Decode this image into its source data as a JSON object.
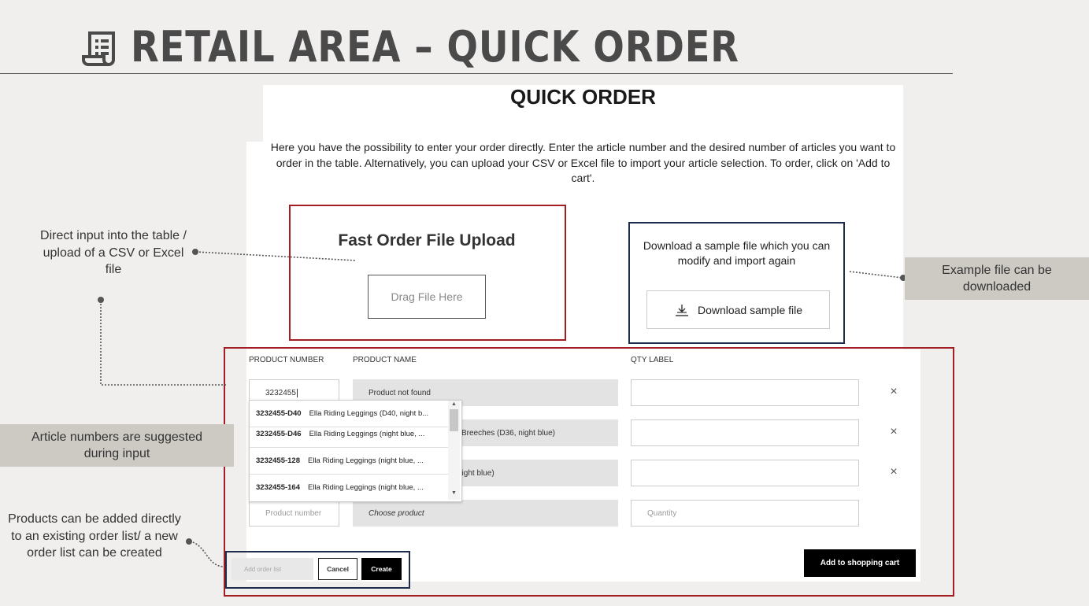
{
  "header": {
    "title": "RETAIL AREA – QUICK ORDER",
    "icon": "document-list-icon"
  },
  "quick_order": {
    "heading": "QUICK ORDER",
    "intro": "Here you have the possibility to enter your order directly. Enter the article number and the desired number of articles you want to order in the table. Alternatively, you can upload your CSV or Excel file to import your article selection. To order, click on 'Add to cart'.",
    "upload": {
      "title": "Fast Order File Upload",
      "drag_label": "Drag File Here"
    },
    "download": {
      "text": "Download a sample file which you can modify and import again",
      "button_label": "Download sample file",
      "icon": "download-icon"
    },
    "table": {
      "headers": {
        "product_number": "PRODUCT NUMBER",
        "product_name": "PRODUCT NAME",
        "qty": "QTY LABEL"
      },
      "rows": [
        {
          "number": "3232455",
          "name": "Product not found"
        },
        {
          "name": "Breeches (D36, night blue)"
        },
        {
          "name": "night blue)"
        }
      ],
      "new_row": {
        "number_placeholder": "Product number",
        "name_placeholder": "Choose product",
        "qty_placeholder": "Quantity"
      },
      "remove_icon": "×"
    },
    "suggestions": [
      {
        "code": "3232455-D40",
        "name": "Ella Riding Leggings (D40, night b..."
      },
      {
        "code": "3232455-D46",
        "name": "Ella Riding Leggings (night blue, ..."
      },
      {
        "code": "3232455-128",
        "name": "Ella Riding Leggings (night blue, ..."
      },
      {
        "code": "3232455-164",
        "name": "Ella Riding Leggings (night blue, ..."
      }
    ],
    "order_list": {
      "placeholder": "Add order list",
      "cancel_label": "Cancel",
      "create_label": "Create"
    },
    "cart_button": "Add to shopping cart"
  },
  "annotations": {
    "direct_input": "Direct input into the table / upload of a CSV or Excel file",
    "example_file": "Example file can be downloaded",
    "suggested": "Article numbers are suggested during input",
    "order_list": "Products can be added directly to an existing order list/ a new order list can be created"
  },
  "colors": {
    "red_frame": "#a31e22",
    "navy_frame": "#1f2d4d",
    "annotation_bg": "#cdcac4"
  }
}
